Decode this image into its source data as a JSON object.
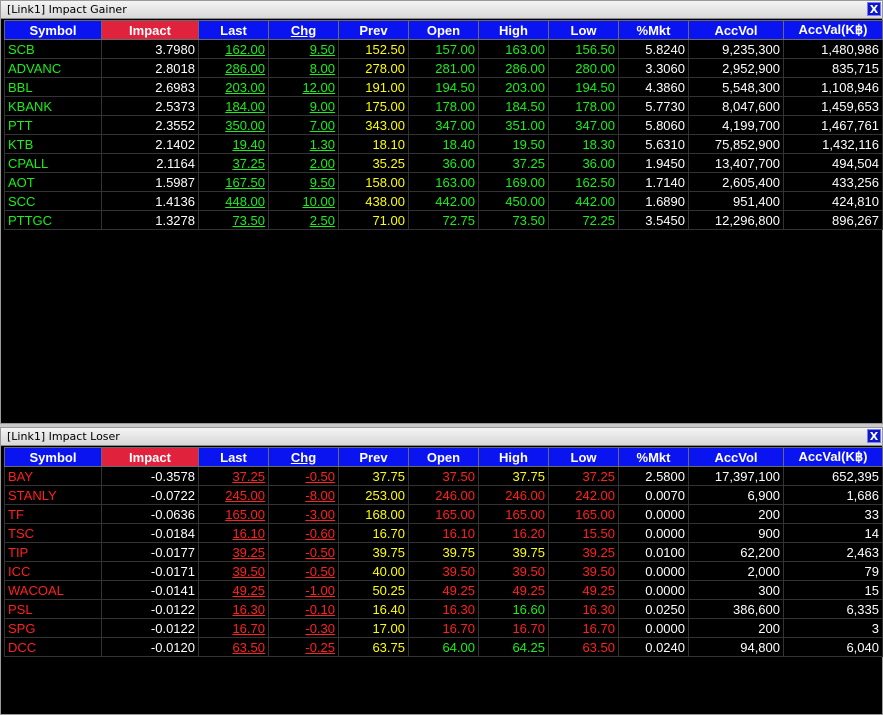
{
  "columns": [
    "Symbol",
    "Impact",
    "Last",
    "Chg",
    "Prev",
    "Open",
    "High",
    "Low",
    "%Mkt",
    "AccVol",
    "AccVal(K฿)"
  ],
  "close_label": "X",
  "colors": {
    "up": "#18f018",
    "down": "#ff2020",
    "unchanged": "#ffff00",
    "neutral": "#ffffff",
    "header_bg": "#0a14f0",
    "sorted_header_bg": "#e0223c"
  },
  "gainer": {
    "title": "[Link1] Impact Gainer",
    "rows": [
      {
        "symbol": "SCB",
        "impact": "3.7980",
        "last": "162.00",
        "chg": "9.50",
        "prev": "152.50",
        "open": "157.00",
        "high": "163.00",
        "low": "156.50",
        "mkt": "5.8240",
        "accvol": "9,235,300",
        "accval": "1,480,986"
      },
      {
        "symbol": "ADVANC",
        "impact": "2.8018",
        "last": "286.00",
        "chg": "8.00",
        "prev": "278.00",
        "open": "281.00",
        "high": "286.00",
        "low": "280.00",
        "mkt": "3.3060",
        "accvol": "2,952,900",
        "accval": "835,715"
      },
      {
        "symbol": "BBL",
        "impact": "2.6983",
        "last": "203.00",
        "chg": "12.00",
        "prev": "191.00",
        "open": "194.50",
        "high": "203.00",
        "low": "194.50",
        "mkt": "4.3860",
        "accvol": "5,548,300",
        "accval": "1,108,946"
      },
      {
        "symbol": "KBANK",
        "impact": "2.5373",
        "last": "184.00",
        "chg": "9.00",
        "prev": "175.00",
        "open": "178.00",
        "high": "184.50",
        "low": "178.00",
        "mkt": "5.7730",
        "accvol": "8,047,600",
        "accval": "1,459,653"
      },
      {
        "symbol": "PTT",
        "impact": "2.3552",
        "last": "350.00",
        "chg": "7.00",
        "prev": "343.00",
        "open": "347.00",
        "high": "351.00",
        "low": "347.00",
        "mkt": "5.8060",
        "accvol": "4,199,700",
        "accval": "1,467,761"
      },
      {
        "symbol": "KTB",
        "impact": "2.1402",
        "last": "19.40",
        "chg": "1.30",
        "prev": "18.10",
        "open": "18.40",
        "high": "19.50",
        "low": "18.30",
        "mkt": "5.6310",
        "accvol": "75,852,900",
        "accval": "1,432,116"
      },
      {
        "symbol": "CPALL",
        "impact": "2.1164",
        "last": "37.25",
        "chg": "2.00",
        "prev": "35.25",
        "open": "36.00",
        "high": "37.25",
        "low": "36.00",
        "mkt": "1.9450",
        "accvol": "13,407,700",
        "accval": "494,504"
      },
      {
        "symbol": "AOT",
        "impact": "1.5987",
        "last": "167.50",
        "chg": "9.50",
        "prev": "158.00",
        "open": "163.00",
        "high": "169.00",
        "low": "162.50",
        "mkt": "1.7140",
        "accvol": "2,605,400",
        "accval": "433,256"
      },
      {
        "symbol": "SCC",
        "impact": "1.4136",
        "last": "448.00",
        "chg": "10.00",
        "prev": "438.00",
        "open": "442.00",
        "high": "450.00",
        "low": "442.00",
        "mkt": "1.6890",
        "accvol": "951,400",
        "accval": "424,810"
      },
      {
        "symbol": "PTTGC",
        "impact": "1.3278",
        "last": "73.50",
        "chg": "2.50",
        "prev": "71.00",
        "open": "72.75",
        "high": "73.50",
        "low": "72.25",
        "mkt": "3.5450",
        "accvol": "12,296,800",
        "accval": "896,267"
      }
    ]
  },
  "loser": {
    "title": "[Link1] Impact Loser",
    "rows": [
      {
        "symbol": "BAY",
        "impact": "-0.3578",
        "last": "37.25",
        "chg": "-0.50",
        "prev": "37.75",
        "open": "37.50",
        "high": "37.75",
        "low": "37.25",
        "mkt": "2.5800",
        "accvol": "17,397,100",
        "accval": "652,395"
      },
      {
        "symbol": "STANLY",
        "impact": "-0.0722",
        "last": "245.00",
        "chg": "-8.00",
        "prev": "253.00",
        "open": "246.00",
        "high": "246.00",
        "low": "242.00",
        "mkt": "0.0070",
        "accvol": "6,900",
        "accval": "1,686"
      },
      {
        "symbol": "TF",
        "impact": "-0.0636",
        "last": "165.00",
        "chg": "-3.00",
        "prev": "168.00",
        "open": "165.00",
        "high": "165.00",
        "low": "165.00",
        "mkt": "0.0000",
        "accvol": "200",
        "accval": "33"
      },
      {
        "symbol": "TSC",
        "impact": "-0.0184",
        "last": "16.10",
        "chg": "-0.60",
        "prev": "16.70",
        "open": "16.10",
        "high": "16.20",
        "low": "15.50",
        "mkt": "0.0000",
        "accvol": "900",
        "accval": "14"
      },
      {
        "symbol": "TIP",
        "impact": "-0.0177",
        "last": "39.25",
        "chg": "-0.50",
        "prev": "39.75",
        "open": "39.75",
        "high": "39.75",
        "low": "39.25",
        "mkt": "0.0100",
        "accvol": "62,200",
        "accval": "2,463"
      },
      {
        "symbol": "ICC",
        "impact": "-0.0171",
        "last": "39.50",
        "chg": "-0.50",
        "prev": "40.00",
        "open": "39.50",
        "high": "39.50",
        "low": "39.50",
        "mkt": "0.0000",
        "accvol": "2,000",
        "accval": "79"
      },
      {
        "symbol": "WACOAL",
        "impact": "-0.0141",
        "last": "49.25",
        "chg": "-1.00",
        "prev": "50.25",
        "open": "49.25",
        "high": "49.25",
        "low": "49.25",
        "mkt": "0.0000",
        "accvol": "300",
        "accval": "15"
      },
      {
        "symbol": "PSL",
        "impact": "-0.0122",
        "last": "16.30",
        "chg": "-0.10",
        "prev": "16.40",
        "open": "16.30",
        "high": "16.60",
        "low": "16.30",
        "mkt": "0.0250",
        "accvol": "386,600",
        "accval": "6,335"
      },
      {
        "symbol": "SPG",
        "impact": "-0.0122",
        "last": "16.70",
        "chg": "-0.30",
        "prev": "17.00",
        "open": "16.70",
        "high": "16.70",
        "low": "16.70",
        "mkt": "0.0000",
        "accvol": "200",
        "accval": "3"
      },
      {
        "symbol": "DCC",
        "impact": "-0.0120",
        "last": "63.50",
        "chg": "-0.25",
        "prev": "63.75",
        "open": "64.00",
        "high": "64.25",
        "low": "63.50",
        "mkt": "0.0240",
        "accvol": "94,800",
        "accval": "6,040"
      }
    ]
  }
}
